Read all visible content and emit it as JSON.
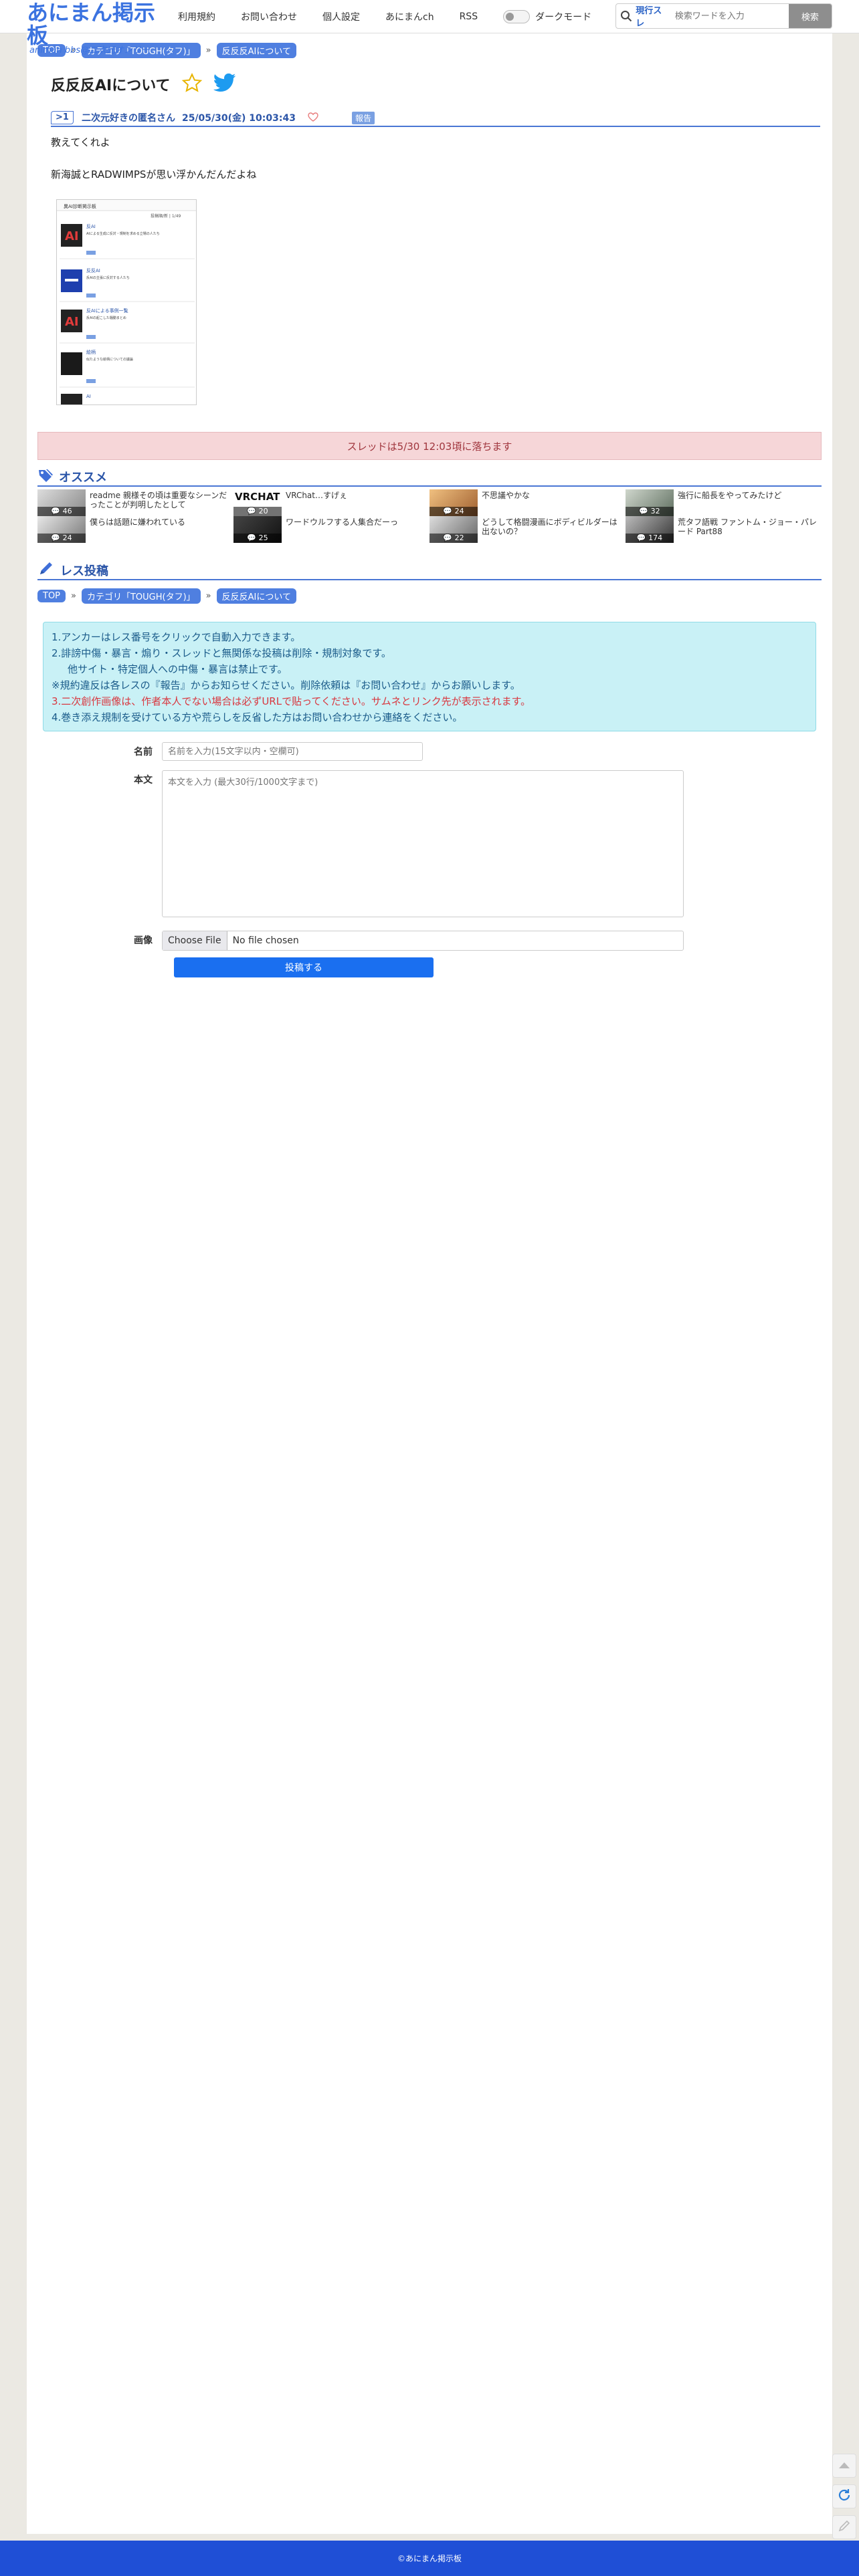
{
  "site": {
    "logo_main": "あにまん掲示板",
    "logo_sub": "animan bbs@二次元オンリー"
  },
  "nav": {
    "items": [
      {
        "label": "利用規約"
      },
      {
        "label": "お問い合わせ"
      },
      {
        "label": "個人設定"
      },
      {
        "label": "あにまんch"
      },
      {
        "label": "RSS"
      }
    ],
    "dark_mode_label": "ダークモード"
  },
  "search": {
    "scope": "現行スレ",
    "placeholder": "検索ワードを入力",
    "button": "検索"
  },
  "breadcrumb": {
    "top": "TOP",
    "category": "カテゴリ「TOUGH(タフ)」",
    "thread": "反反反AIについて"
  },
  "thread": {
    "title": "反反反AIについて"
  },
  "post": {
    "number": ">1",
    "name": "二次元好きの匿名さん",
    "date": "25/05/30(金) 10:03:43",
    "report": "報告",
    "lines": [
      "教えてくれよ",
      "新海誠とRADWIMPSが思い浮かんだんだよね"
    ]
  },
  "thumb": {
    "header": "異AI診断掲示板",
    "sub": "投稿順/新 | 1/49",
    "entries": [
      {
        "title": "反AI",
        "text": "AIによる生成に反対・規制を求める立場の人たち"
      },
      {
        "title": "反反AI",
        "text": "反AIの主張に反対する人たち"
      },
      {
        "title": "反AIによる事例一覧",
        "text": "反AIの起こした騒動まとめ"
      },
      {
        "title": "絵柄",
        "text": "似たような絵柄についての議論"
      },
      {
        "title": "AI",
        "text": ""
      }
    ]
  },
  "fall_notice": "スレッドは5/30 12:03頃に落ちます",
  "recommend": {
    "title": "オススメ",
    "items": [
      {
        "title": "readme 親様その頃は重要なシーンだったことが判明したとして",
        "count": "46"
      },
      {
        "title": "VRChat…すげぇ",
        "count": "20"
      },
      {
        "title": "不思議やかな",
        "count": "24"
      },
      {
        "title": "強行に船長をやってみたけど",
        "count": "32"
      },
      {
        "title": "僕らは話題に嫌われている",
        "count": "24"
      },
      {
        "title": "ワードウルフする人集合だーっ",
        "count": "25"
      },
      {
        "title": "どうして格闘漫画にボディビルダーは出ないの？",
        "count": "22"
      },
      {
        "title": "荒タフ語戦 ファントム・ジョー・パレード Part88",
        "count": "174"
      }
    ]
  },
  "post_form": {
    "title": "レス投稿",
    "notice": [
      "1.アンカーはレス番号をクリックで自動入力できます。",
      "2.誹謗中傷・暴言・煽り・スレッドと無関係な投稿は削除・規制対象です。",
      "他サイト・特定個人への中傷・暴言は禁止です。",
      "※規約違反は各レスの『報告』からお知らせください。削除依頼は『お問い合わせ』からお願いします。",
      "3.二次創作画像は、作者本人でない場合は必ずURLで貼ってください。サムネとリンク先が表示されます。",
      "4.巻き添え規制を受けている方や荒らしを反省した方はお問い合わせから連絡をください。"
    ],
    "name_label": "名前",
    "name_placeholder": "名前を入力(15文字以内・空欄可)",
    "body_label": "本文",
    "body_placeholder": "本文を入力 (最大30行/1000文字まで)",
    "image_label": "画像",
    "file_button": "Choose File",
    "file_status": "No file chosen",
    "submit": "投稿する"
  },
  "footer": {
    "text": "©あにまん掲示板"
  }
}
